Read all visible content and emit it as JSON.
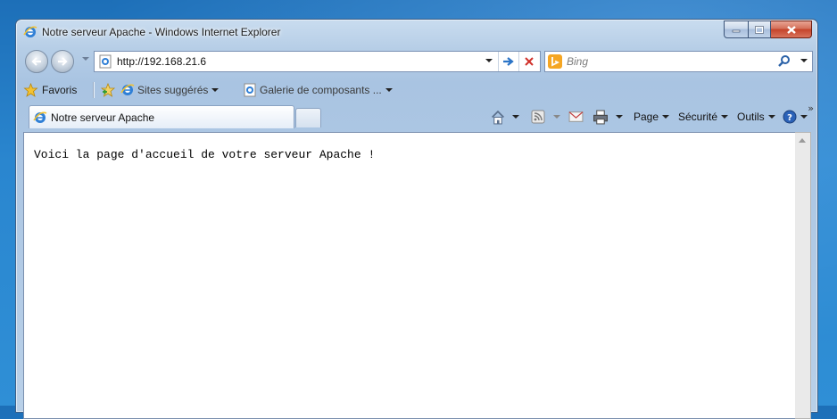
{
  "window": {
    "title": "Notre serveur Apache - Windows Internet Explorer"
  },
  "navigation": {
    "address": "http://192.168.21.6",
    "search_placeholder": "Bing"
  },
  "favorites_bar": {
    "favorites_label": "Favoris",
    "suggested_sites_label": "Sites suggérés",
    "gallery_label": "Galerie de composants ..."
  },
  "tabs": [
    {
      "label": "Notre serveur Apache"
    }
  ],
  "command_bar": {
    "page_label": "Page",
    "security_label": "Sécurité",
    "tools_label": "Outils",
    "more_chevrons": "»"
  },
  "page": {
    "body_text": "Voici la page d'accueil de votre serveur Apache !"
  },
  "icons": [
    "ie-icon",
    "back-arrow-icon",
    "forward-arrow-icon",
    "go-arrow-icon",
    "stop-icon",
    "bing-icon",
    "search-icon",
    "favorites-star-icon",
    "add-favorite-icon",
    "home-icon",
    "rss-feed-icon",
    "mail-icon",
    "print-icon",
    "help-icon"
  ],
  "colors": {
    "desktop_blue": "#2a86cf",
    "window_frame": "#b5cde6",
    "close_red": "#c5432a",
    "go_blue": "#2b74c7",
    "stop_red": "#d0302a",
    "bing_orange": "#f5a623"
  }
}
